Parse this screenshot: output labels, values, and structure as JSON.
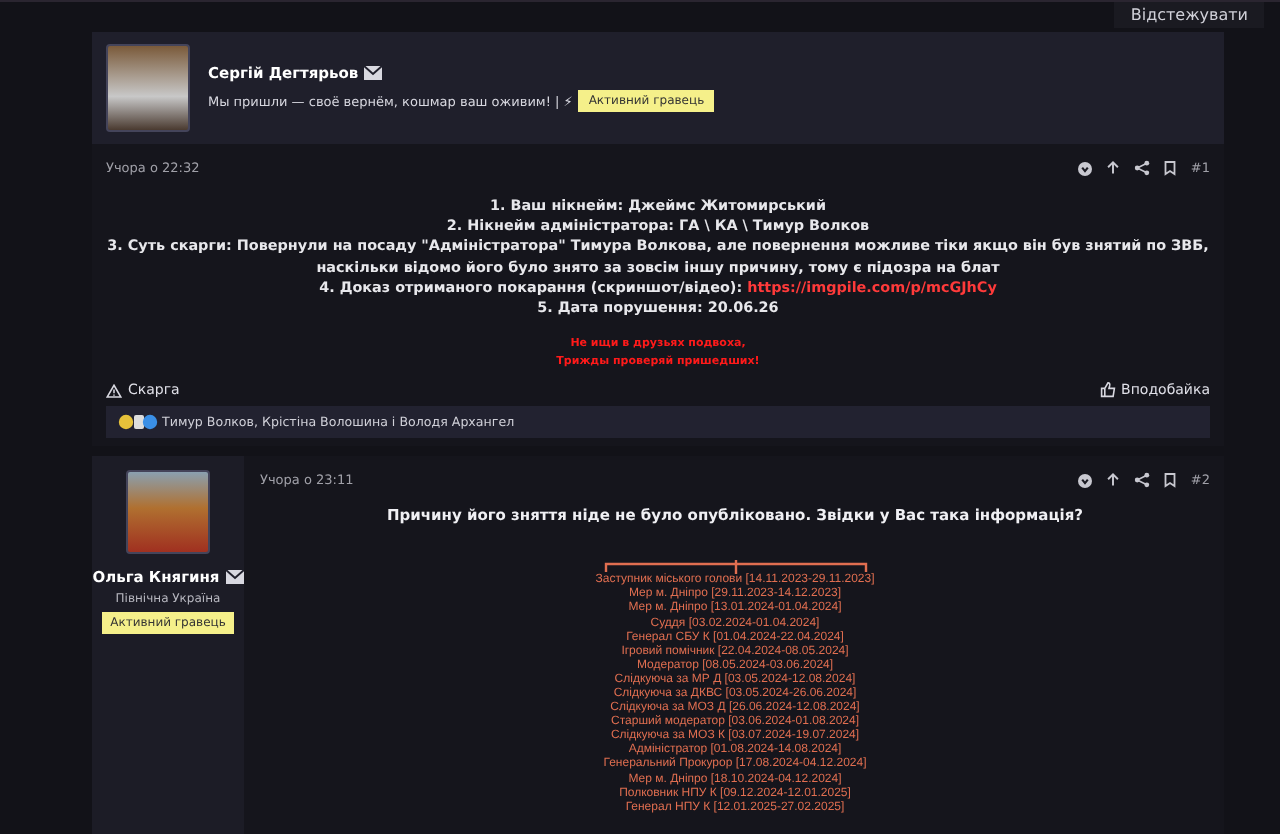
{
  "top_button": "Відстежувати",
  "posts": [
    {
      "author": "Сергій Дегтярьов",
      "signature": "Мы пришли — своё вернём, кошмар ваш оживим! | ⚡",
      "badge": "Активний гравець",
      "time": "Учора о 22:32",
      "number": "#1",
      "lines": [
        {
          "kind": "text",
          "text": "1. Ваш нікнейм: Джеймс Житомирський"
        },
        {
          "kind": "text",
          "text": "2. Нікнейм адміністратора: ГА \\ КА \\ Тимур Волков"
        },
        {
          "kind": "text",
          "text": "3. Суть скарги: Повернули на посаду \"Адміністратора\" Тимура Волкова, але повернення можливе тіки якщо він був знятий по ЗВБ, наскільки відомо його було знято за зовсім іншу причину, тому є підозра на блат"
        },
        {
          "kind": "link",
          "text": "4. Доказ отриманого покарання (скриншот/відео): ",
          "link": "https://imgpile.com/p/mcGJhCy"
        },
        {
          "kind": "text",
          "text": "5. Дата порушення: 20.06.26"
        }
      ],
      "signature_lines": [
        "Не ищи в друзьях подвоха,",
        "Трижды проверяй пришедших!"
      ],
      "report": "Скарга",
      "like": "Вподобайка",
      "reactions": "Тимур Волков, Крістіна Волошина і Володя Архангел"
    },
    {
      "author": "Ольга Княгиня",
      "title": "Північна Україна",
      "badge": "Активний гравець",
      "time": "Учора о 23:11",
      "number": "#2",
      "question": "Причину його зняття ніде не було опубліковано. Звідки у Вас така інформація?",
      "roles": [
        "Заступник міського голови [14.11.2023-29.11.2023]",
        "Мер м. Дніпро [29.11.2023-14.12.2023]",
        "Мер м. Дніпро [13.01.2024-01.04.2024]",
        "Суддя [03.02.2024-01.04.2024]",
        "Генерал СБУ К [01.04.2024-22.04.2024]",
        "Ігровий помічник [22.04.2024-08.05.2024]",
        "Модератор [08.05.2024-03.06.2024]",
        "Слідкуюча за МР Д [03.05.2024-12.08.2024]",
        "Слідкуюча за ДКВС [03.05.2024-26.06.2024]",
        "Слідкуюча за МОЗ Д [26.06.2024-12.08.2024]",
        "Старший модератор [03.06.2024-01.08.2024]",
        "Слідкуюча за МОЗ К [03.07.2024-19.07.2024]",
        "Адміністратор [01.08.2024-14.08.2024]",
        "Генеральний Прокурор [17.08.2024-04.12.2024]",
        "Мер м. Дніпро [18.10.2024-04.12.2024]",
        "Полковник НПУ К [09.12.2024-12.01.2025]",
        "Генерал НПУ К [12.01.2025-27.02.2025]"
      ]
    }
  ]
}
